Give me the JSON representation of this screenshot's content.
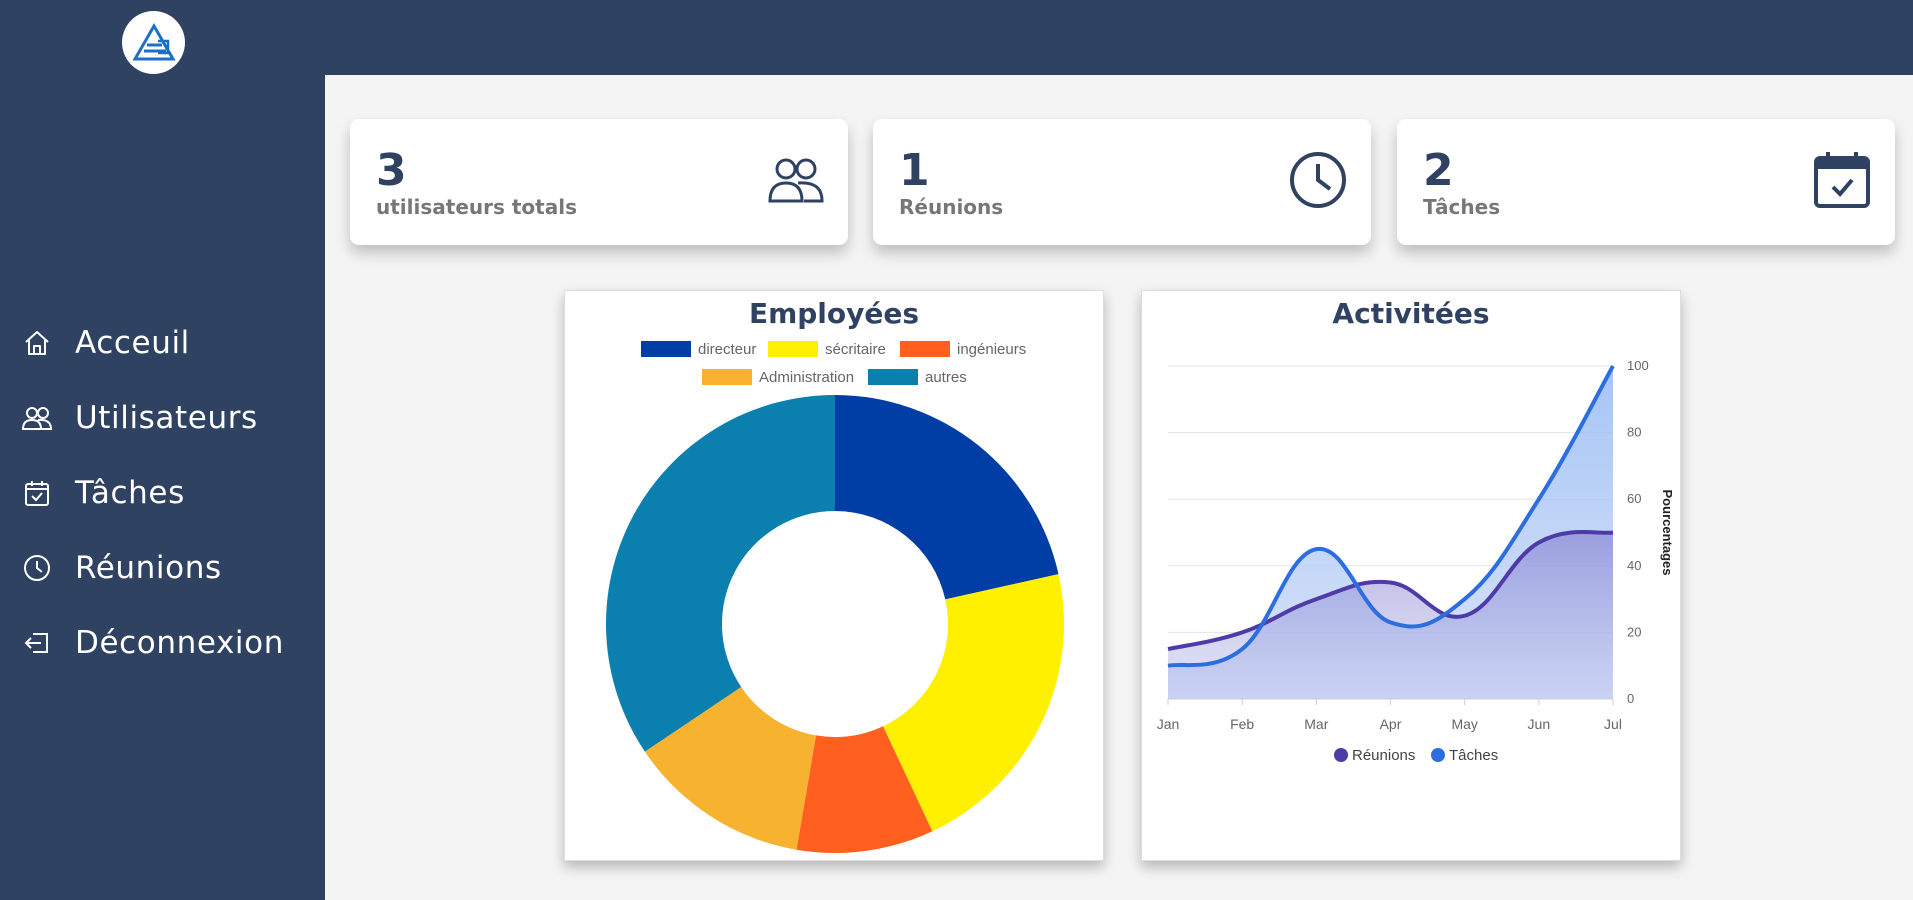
{
  "sidebar": {
    "items": [
      {
        "label": "Acceuil",
        "icon": "home-icon"
      },
      {
        "label": "Utilisateurs",
        "icon": "users-icon"
      },
      {
        "label": "Tâches",
        "icon": "calendar-check-icon"
      },
      {
        "label": "Réunions",
        "icon": "clock-icon"
      },
      {
        "label": "Déconnexion",
        "icon": "logout-icon"
      }
    ]
  },
  "stats": [
    {
      "value": "3",
      "caption": "utilisateurs totals",
      "icon": "users-icon"
    },
    {
      "value": "1",
      "caption": "Réunions",
      "icon": "clock-icon"
    },
    {
      "value": "2",
      "caption": "Tâches",
      "icon": "calendar-check-icon"
    }
  ],
  "colors": {
    "primary": "#2f4261",
    "background": "#f4f4f4",
    "accent_blue": "#2c6de0",
    "accent_purple": "#4f3ba8"
  },
  "chart_data": [
    {
      "type": "pie",
      "title": "Employées",
      "legend": [
        {
          "label": "directeur",
          "color": "#003da5"
        },
        {
          "label": "sécritaire",
          "color": "#fff000"
        },
        {
          "label": "ingénieurs",
          "color": "#ff5f1f"
        },
        {
          "label": "Administration",
          "color": "#f7b22f"
        },
        {
          "label": "autres",
          "color": "#0b7fad"
        }
      ],
      "values": [
        20,
        20,
        9,
        12,
        32
      ],
      "legend_position": "top"
    },
    {
      "type": "area",
      "title": "Activitées",
      "categories": [
        "Jan",
        "Feb",
        "Mar",
        "Apr",
        "May",
        "Jun",
        "Jul"
      ],
      "series": [
        {
          "name": "Réunions",
          "values": [
            15,
            20,
            30,
            35,
            25,
            47,
            50
          ],
          "color": "#4f3ba8"
        },
        {
          "name": "Tâches",
          "values": [
            10,
            15,
            45,
            23,
            30,
            60,
            100
          ],
          "color": "#2c6de0"
        }
      ],
      "ylabel": "Pourcentages",
      "yticks": [
        0,
        20,
        40,
        60,
        80,
        100
      ],
      "ylim": [
        0,
        100
      ],
      "y_axis_side": "right",
      "grid": true,
      "legend_position": "bottom"
    }
  ]
}
